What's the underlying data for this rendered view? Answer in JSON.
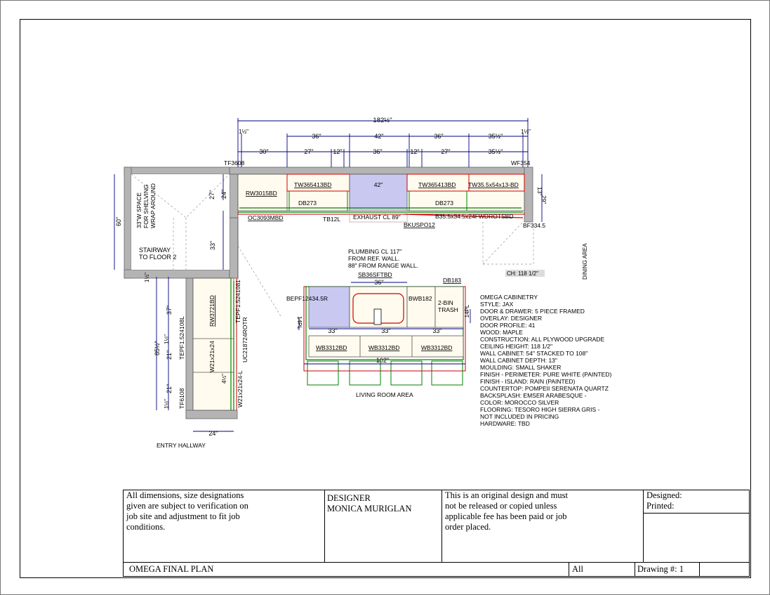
{
  "plan": {
    "overall_width": "182½\"",
    "top_dims_row1": [
      "36\"",
      "42\"",
      "36\"",
      "35½\""
    ],
    "top_dims_row2": [
      "30\"",
      "27\"",
      "12\"",
      "36\"",
      "12\"",
      "27\"",
      "35½\""
    ],
    "top_stub_left": "1½\"",
    "top_stub_right": "1½\"",
    "corner_left": "TF3608",
    "corner_right": "WF354",
    "wall_cabinets": [
      "RW3015BD",
      "TW365413BD",
      "TW365413BD",
      "TW35.5x54x13-BD"
    ],
    "hood_width": "42\"",
    "base_cabinets": [
      "DB273",
      "DB273"
    ],
    "below_labels": [
      "OC3093MBD",
      "TB12L",
      "EXHAUST CL 89\"",
      "B35.5x34.5x24FWDROTSBD",
      "BKUSPO12",
      "BF334.5"
    ],
    "right_dims": [
      "13\"",
      "29\""
    ],
    "left_dims": [
      "24\"",
      "27\"",
      "33\"",
      "60\""
    ],
    "stair_note": "33\"W SPACE FOR SHELVING WRAP AROUND",
    "stairway": [
      "STAIRWAY",
      "TO FLOOR 2"
    ],
    "dining": "DINING AREA",
    "ceiling_tag": "CH: 118 1/2\"",
    "plumbing": [
      "PLUMBING CL 117\"",
      "FROM REF. WALL.",
      "88\" FROM RANGE WALL."
    ],
    "island_top": [
      "SB36SFTBD",
      "DB183",
      "36\""
    ],
    "island_labels": [
      "BEPF12434.5R",
      "BWB182",
      "2-BIN",
      "TRASH",
      "14PL",
      "14PL"
    ],
    "island_dims": [
      "33\"",
      "33\"",
      "33\"",
      "102\""
    ],
    "island_bottom": [
      "WB3312BD",
      "WB3312BD",
      "WB3312BD"
    ],
    "living_room": "LIVING ROOM AREA",
    "left_run": [
      "RW3721BD",
      "W21x21x24",
      "W21x21x24-L",
      "TEPF1.5241081",
      "TEPF1.524108L",
      "UC218724ROTR",
      "TF6108",
      "RW3721"
    ],
    "left_run_dims": [
      "1½\"",
      "37\"",
      "85½\"",
      "1½\"",
      "21\"",
      "21\"",
      "1½\"",
      "4½\"",
      "24\""
    ],
    "entry": "ENTRY HALLWAY"
  },
  "specs": [
    "OMEGA CABINETRY",
    "STYLE: JAX",
    "DOOR & DRAWER: 5 PIECE FRAMED",
    "OVERLAY: DESIGNER",
    "DOOR PROFILE: 41",
    "WOOD: MAPLE",
    "CONSTRUCTION: ALL PLYWOOD UPGRADE",
    "CEILING HEIGHT: 118 1/2\"",
    "WALL CABINET: 54\" STACKED TO 108\"",
    "WALL CABINET DEPTH: 13\"",
    "MOULDING: SMALL SHAKER",
    "FINISH - PERIMETER: PURE WHITE (PAINTED)",
    "FINISH - ISLAND: RAIN (PAINTED)",
    "COUNTERTOP: POMPEII SERENATA QUARTZ",
    "BACKSPLASH: EMSER ARABESQUE -",
    "COLOR: MOROCCO SILVER",
    "FLOORING: TESORO HIGH SIERRA GRIS -",
    "NOT INCLUDED IN PRICING",
    "HARDWARE: TBD"
  ],
  "title_block": {
    "disclaimer": [
      "All dimensions, size designations",
      "given are subject to verification on",
      "job site and adjustment to fit job",
      "conditions."
    ],
    "designer_label": "DESIGNER",
    "designer_name": "MONICA MURIGLAN",
    "notice": [
      "This is an original design and must",
      "not be released or copied unless",
      "applicable fee has been paid or job",
      "order placed."
    ],
    "designed_label": "Designed:",
    "printed_label": "Printed:",
    "plan_name": "OMEGA FINAL PLAN",
    "scale": "All",
    "drawing_label": "Drawing #: 1"
  },
  "colors": {
    "wall": "#b4b4b4",
    "dimension": "#000080",
    "cabinet_fill": "#fffbee",
    "hood_fill": "#c8c8f0",
    "countertop": "#008000",
    "accent_red": "#d00000"
  }
}
